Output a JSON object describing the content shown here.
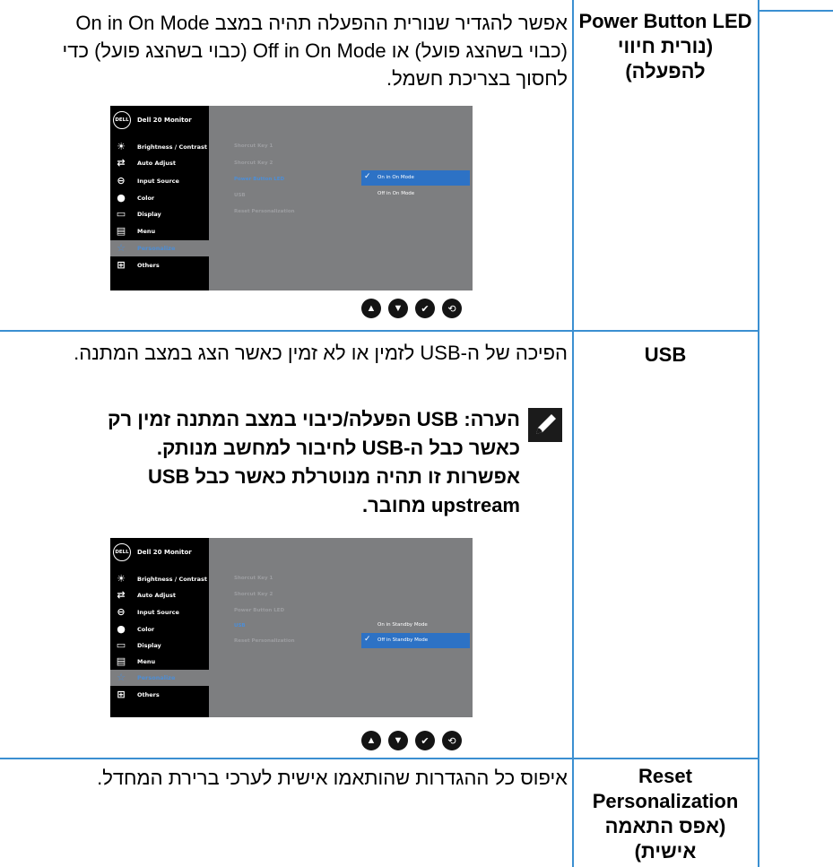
{
  "rows": [
    {
      "term": "Power Button LED",
      "term_he": "(נורית חיווי להפעלה)",
      "description": "אפשר להגדיר שנורית ההפעלה תהיה במצב On in On Mode (כבוי בשהצג פועל) או Off in On Mode (כבוי בשהצג פועל) כדי לחסוך בצריכת חשמל.",
      "osd": {
        "model": "Dell 20 Monitor",
        "logo": "DELL",
        "menu": [
          {
            "icon": "brightness-icon",
            "glyph": "☀",
            "label": "Brightness / Contrast"
          },
          {
            "icon": "auto-adjust-icon",
            "glyph": "⇄",
            "label": "Auto Adjust"
          },
          {
            "icon": "input-source-icon",
            "glyph": "⊖",
            "label": "Input Source"
          },
          {
            "icon": "color-icon",
            "glyph": "●",
            "label": "Color"
          },
          {
            "icon": "display-icon",
            "glyph": "▭",
            "label": "Display"
          },
          {
            "icon": "menu-icon",
            "glyph": "▤",
            "label": "Menu"
          },
          {
            "icon": "personalize-icon",
            "glyph": "☆",
            "label": "Personalize"
          },
          {
            "icon": "others-icon",
            "glyph": "⊞",
            "label": "Others"
          }
        ],
        "submenu": [
          "Shorcut Key 1",
          "Shorcut Key 2",
          "Power Button LED",
          "USB",
          "Reset Personalization"
        ],
        "options": [
          "On in On Mode",
          "Off in On Mode"
        ]
      }
    },
    {
      "term": "USB",
      "description": "הפיכה של ה-USB לזמין או לא זמין כאשר הצג במצב המתנה.",
      "note": "הערה: USB הפעלה/כיבוי במצב המתנה זמין רק כאשר כבל ה-USB לחיבור למחשב מנותק. אפשרות זו תהיה מנוטרלת כאשר כבל USB upstream מחובר.",
      "osd": {
        "options": [
          "On in Standby Mode",
          "Off in Standby Mode"
        ]
      }
    },
    {
      "term": "Reset Personalization",
      "term_he": "(אפס התאמה אישית)",
      "description": "איפוס כל ההגדרות שהותאמו אישית לערכי ברירת המחדל."
    }
  ],
  "nav_buttons": [
    {
      "icon": "up-arrow-icon",
      "glyph": "▲"
    },
    {
      "icon": "down-arrow-icon",
      "glyph": "▼"
    },
    {
      "icon": "check-icon",
      "glyph": "✔"
    },
    {
      "icon": "back-icon",
      "glyph": "⟲"
    }
  ],
  "colors": {
    "table_border": "#3b8fd1",
    "osd_highlight": "#2d72c5"
  }
}
